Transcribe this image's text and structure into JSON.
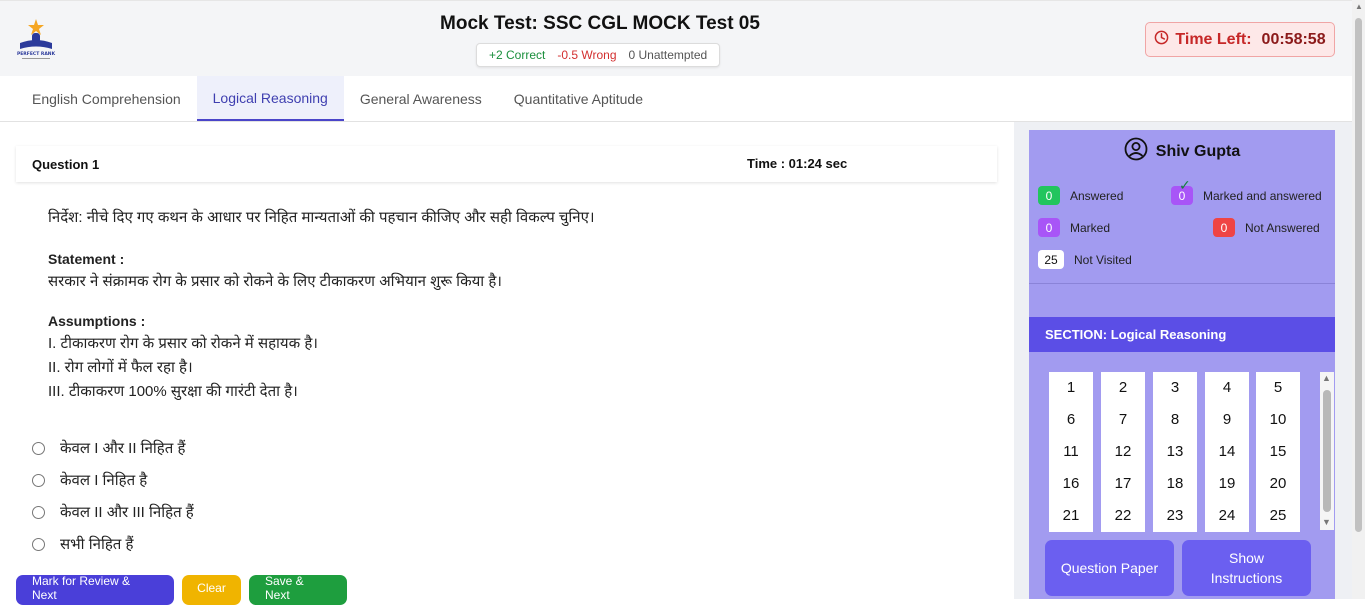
{
  "header": {
    "title": "Mock Test: SSC CGL MOCK Test 05",
    "correct": "+2 Correct",
    "wrong": "-0.5 Wrong",
    "unattempted": "0 Unattempted",
    "timer_label": "Time Left:",
    "timer_value": "00:58:58",
    "logo_text": "PERFECT RANK"
  },
  "tabs": [
    {
      "label": "English Comprehension",
      "active": false
    },
    {
      "label": "Logical Reasoning",
      "active": true
    },
    {
      "label": "General Awareness",
      "active": false
    },
    {
      "label": "Quantitative Aptitude",
      "active": false
    }
  ],
  "question": {
    "number_label": "Question 1",
    "time_label": "Time : 01:24 sec",
    "direction": "निर्देश: नीचे दिए गए कथन के आधार पर निहित मान्यताओं की पहचान कीजिए और सही विकल्प चुनिए।",
    "statement_label": "Statement :",
    "statement": "सरकार ने संक्रामक रोग के प्रसार को रोकने के लिए टीकाकरण अभियान शुरू किया है।",
    "assumptions_label": "Assumptions :",
    "assumptions": [
      "I. टीकाकरण रोग के प्रसार को रोकने में सहायक है।",
      "II. रोग लोगों में फैल रहा है।",
      "III. टीकाकरण 100% सुरक्षा की गारंटी देता है।"
    ],
    "options": [
      "केवल I और II निहित हैं",
      "केवल I निहित है",
      "केवल II और III निहित हैं",
      "सभी निहित हैं"
    ]
  },
  "actions": {
    "review": "Mark for Review & Next",
    "clear": "Clear",
    "save": "Save & Next"
  },
  "panel": {
    "user_name": "Shiv Gupta",
    "legend": {
      "answered_count": "0",
      "answered_label": "Answered",
      "marked_answered_count": "0",
      "marked_answered_label": "Marked and answered",
      "marked_count": "0",
      "marked_label": "Marked",
      "not_answered_count": "0",
      "not_answered_label": "Not Answered",
      "not_visited_count": "25",
      "not_visited_label": "Not Visited"
    },
    "section_label": "SECTION: Logical Reasoning",
    "question_numbers": [
      "1",
      "2",
      "3",
      "4",
      "5",
      "6",
      "7",
      "8",
      "9",
      "10",
      "11",
      "12",
      "13",
      "14",
      "15",
      "16",
      "17",
      "18",
      "19",
      "20",
      "21",
      "22",
      "23",
      "24",
      "25"
    ],
    "question_paper": "Question Paper",
    "show_instructions": "Show Instructions"
  },
  "colors": {
    "accent": "#5b4ee6",
    "panel": "#a29bf0",
    "answered": "#22c55e",
    "marked": "#a855f7",
    "not_answered": "#ef4444"
  }
}
